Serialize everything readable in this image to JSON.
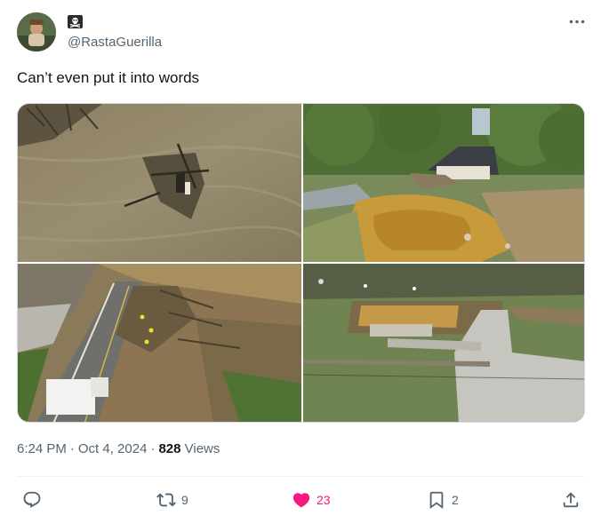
{
  "author": {
    "handle": "@RastaGuerilla",
    "badge_icon": "skull-crossbones-icon"
  },
  "tweet": {
    "text": "Can’t even put it into words"
  },
  "media": {
    "photos": [
      {
        "name": "flooded-river-debris-photo"
      },
      {
        "name": "washed-out-house-photo"
      },
      {
        "name": "collapsed-road-photo"
      },
      {
        "name": "destroyed-house-foundation-photo"
      }
    ]
  },
  "meta": {
    "time": "6:24 PM",
    "separator": "·",
    "date": "Oct 4, 2024",
    "views_count": "828",
    "views_label": "Views"
  },
  "actions": {
    "reply_count": "",
    "retweet_count": "9",
    "like_count": "23",
    "bookmark_count": "2"
  },
  "colors": {
    "text_primary": "#0f1419",
    "text_secondary": "#536471",
    "like_active": "#f91880",
    "divider": "#eff3f4"
  }
}
